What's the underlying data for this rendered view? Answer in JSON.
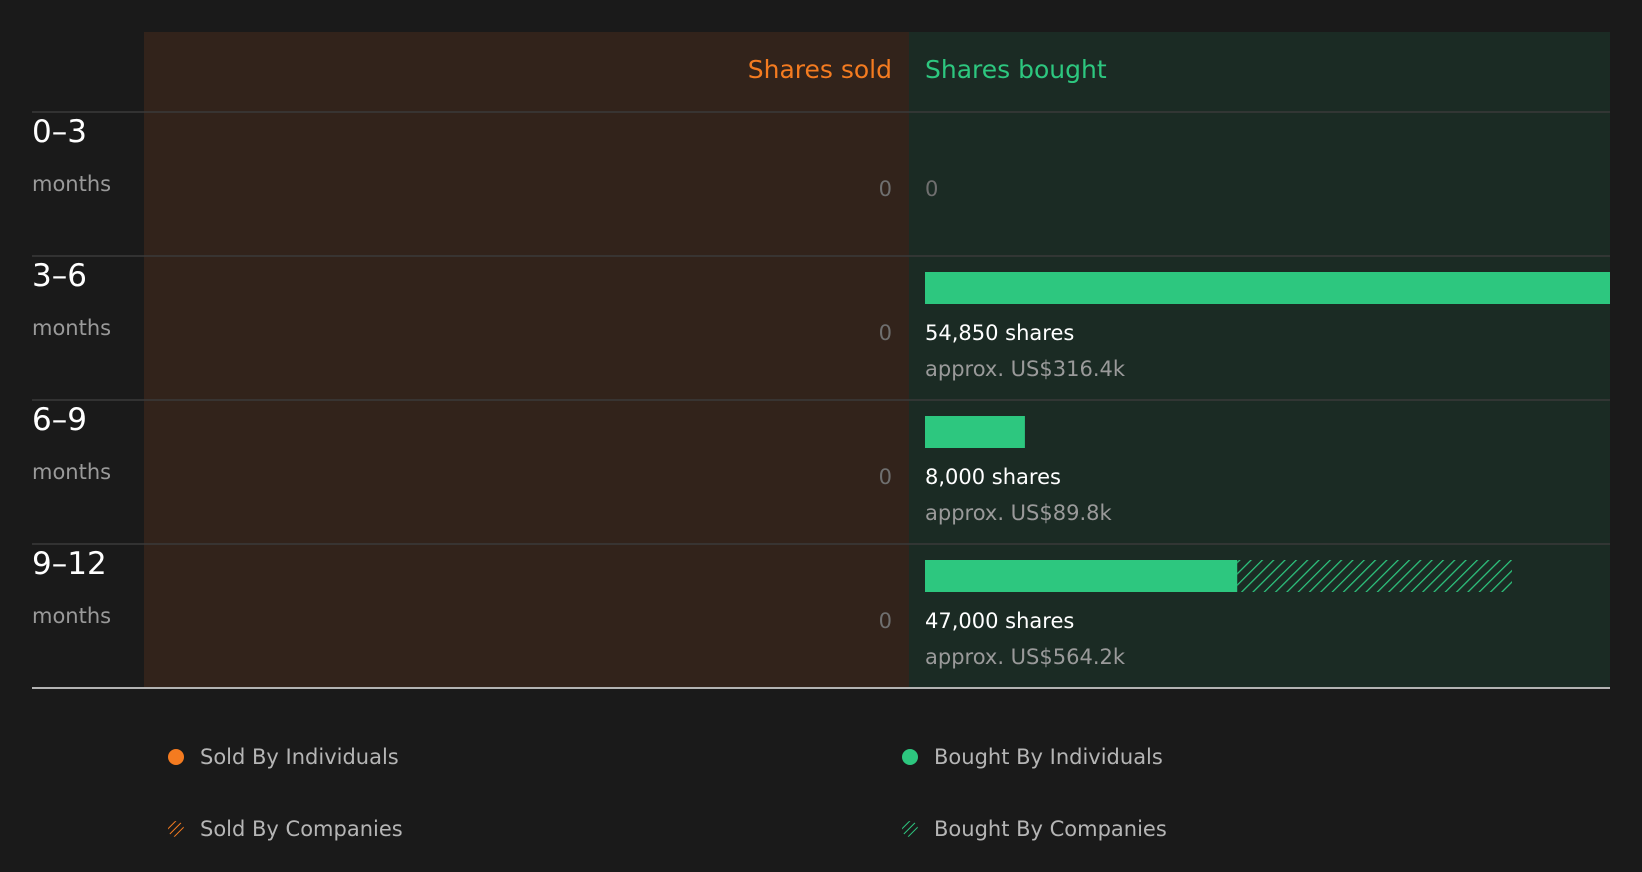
{
  "colors": {
    "background": "#1a1a1a",
    "sold_panel": "#32231b",
    "bought_panel": "#1b2b24",
    "sold_accent": "#f47b20",
    "bought_accent": "#2dc77f",
    "grid": "#3a3a3a",
    "baseline": "#b3b3b3",
    "label_primary": "#ffffff",
    "label_secondary": "#9a9a9a",
    "zero_text": "#6f6f6f"
  },
  "chart_data": {
    "type": "bar",
    "orientation": "horizontal",
    "headers": {
      "sold": "Shares sold",
      "bought": "Shares bought"
    },
    "categories": [
      {
        "range": "0–3",
        "unit": "months"
      },
      {
        "range": "3–6",
        "unit": "months"
      },
      {
        "range": "6–9",
        "unit": "months"
      },
      {
        "range": "9–12",
        "unit": "months"
      }
    ],
    "sold": {
      "by_individuals": [
        0,
        0,
        0,
        0
      ],
      "by_companies": [
        0,
        0,
        0,
        0
      ],
      "labels": [
        "0",
        "0",
        "0",
        "0"
      ]
    },
    "bought": {
      "by_individuals": [
        0,
        54850,
        8000,
        25000
      ],
      "by_companies": [
        0,
        0,
        0,
        22000
      ],
      "share_labels": [
        "0",
        "54,850 shares",
        "8,000 shares",
        "47,000 shares"
      ],
      "value_labels": [
        "",
        "approx. US$316.4k",
        "approx. US$89.8k",
        "approx. US$564.2k"
      ]
    },
    "xlim": [
      0,
      54850
    ],
    "legend": [
      {
        "label": "Sold By Individuals",
        "style": "solid",
        "side": "sold"
      },
      {
        "label": "Bought By Individuals",
        "style": "solid",
        "side": "bought"
      },
      {
        "label": "Sold By Companies",
        "style": "hatched",
        "side": "sold"
      },
      {
        "label": "Bought By Companies",
        "style": "hatched",
        "side": "bought"
      }
    ]
  }
}
